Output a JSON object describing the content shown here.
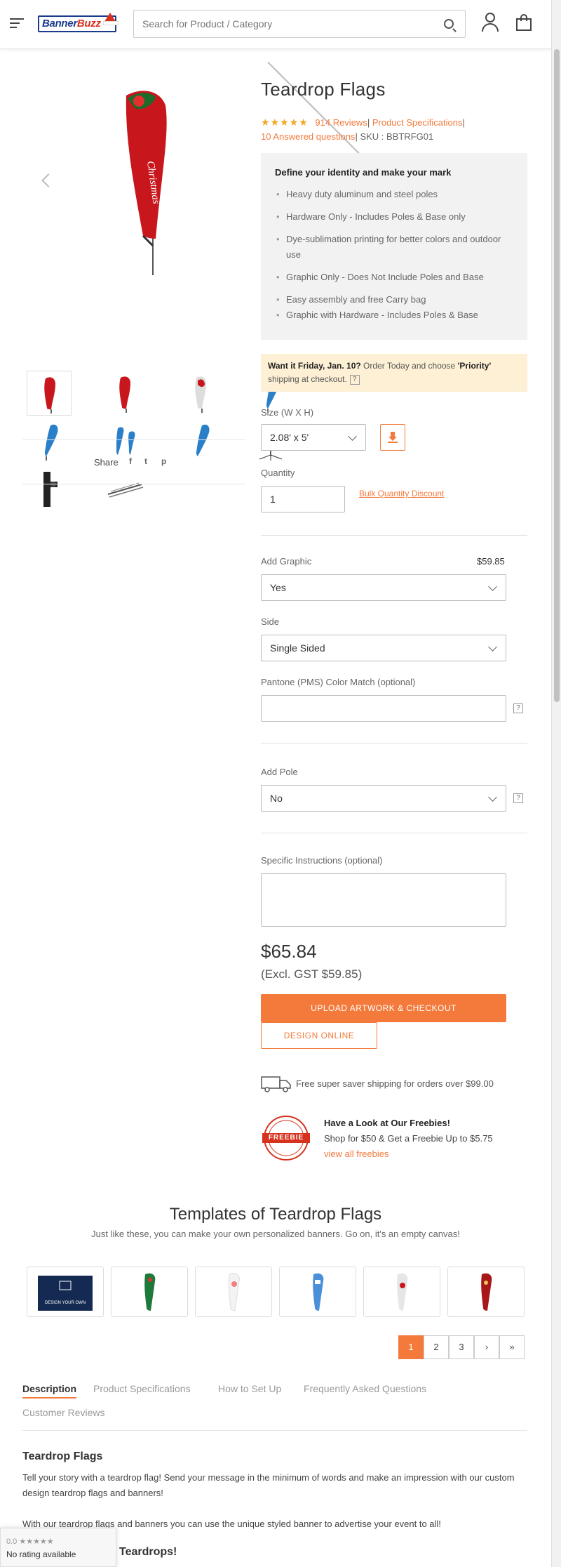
{
  "header": {
    "logo_text_a": "Banner",
    "logo_text_b": "Buzz",
    "search_placeholder": "Search for Product / Category"
  },
  "share": {
    "label": "Share",
    "facebook": "f",
    "twitter": "t",
    "pinterest": "p"
  },
  "product": {
    "title": "Teardrop Flags",
    "stars": "★★★★★",
    "reviews": "914 Reviews",
    "specs_link": "Product Specifications",
    "answered": "10 Answered questions",
    "sku": "SKU : BBTRFG01",
    "sep": "|",
    "features_heading": "Define your identity and make your mark",
    "features": [
      "Heavy duty aluminum and steel poles",
      "Hardware Only - Includes Poles & Base only",
      "Dye-sublimation printing for better colors and outdoor use",
      "Graphic Only - Does Not Include Poles and Base",
      "Easy assembly and free Carry bag",
      "Graphic with Hardware - Includes Poles & Base"
    ],
    "delivery_a": "Want it Friday, Jan. 10?",
    "delivery_b": " Order Today and choose ",
    "delivery_c": "'Priority'",
    "delivery_d": "shipping at checkout.",
    "size_label": "Size (W X H)",
    "size_value": "2.08' x 5'",
    "quantity_label": "Quantity",
    "quantity_value": "1",
    "bulk_link": "Bulk Quantity Discount",
    "add_graphic_label": "Add Graphic",
    "add_graphic_price": "$59.85",
    "add_graphic_value": "Yes",
    "side_label": "Side",
    "side_value": "Single Sided",
    "pantone_label": "Pantone (PMS) Color Match (optional)",
    "add_pole_label": "Add Pole",
    "add_pole_value": "No",
    "instructions_label": "Specific Instructions (optional)",
    "price": "$65.84",
    "price_ex": "(Excl. GST $59.85)",
    "upload_btn": "UPLOAD ARTWORK & CHECKOUT",
    "design_btn": "DESIGN ONLINE",
    "shipping": "Free super saver shipping for orders over $99.00",
    "freebie_heading": "Have a Look at Our Freebies!",
    "freebie_sub": "Shop for $50 & Get a Freebie Up to $5.75",
    "freebie_link": "view all freebies",
    "freebie_badge": "FREEBIE",
    "help": "?"
  },
  "templates": {
    "title": "Templates of Teardrop Flags",
    "subtitle": "Just like these, you can make your own personalized banners. Go on, it's an empty canvas!",
    "design_own": "DESIGN YOUR OWN",
    "pages": [
      "1",
      "2",
      "3",
      "›",
      "»"
    ]
  },
  "tabs": [
    "Description",
    "Product Specifications",
    "How to Set Up",
    "Frequently Asked Questions",
    "Customer Reviews"
  ],
  "description": {
    "heading": "Teardrop Flags",
    "p1": "Tell your story with a teardrop flag! Send your message in the minimum of words and make an impression with our custom design teardrop flags and banners!",
    "p2": "With our teardrop flags and banners you can use the unique styled banner to advertise your event to all!",
    "heading2": "Teardrops!"
  },
  "rating_widget": {
    "score": "0.0 ★★★★★",
    "text": "No rating available"
  },
  "colors": {
    "accent": "#f47a3c",
    "brand_blue": "#1a3b8c",
    "flag_red": "#c8161d",
    "flag_blue": "#2a7fc9"
  }
}
